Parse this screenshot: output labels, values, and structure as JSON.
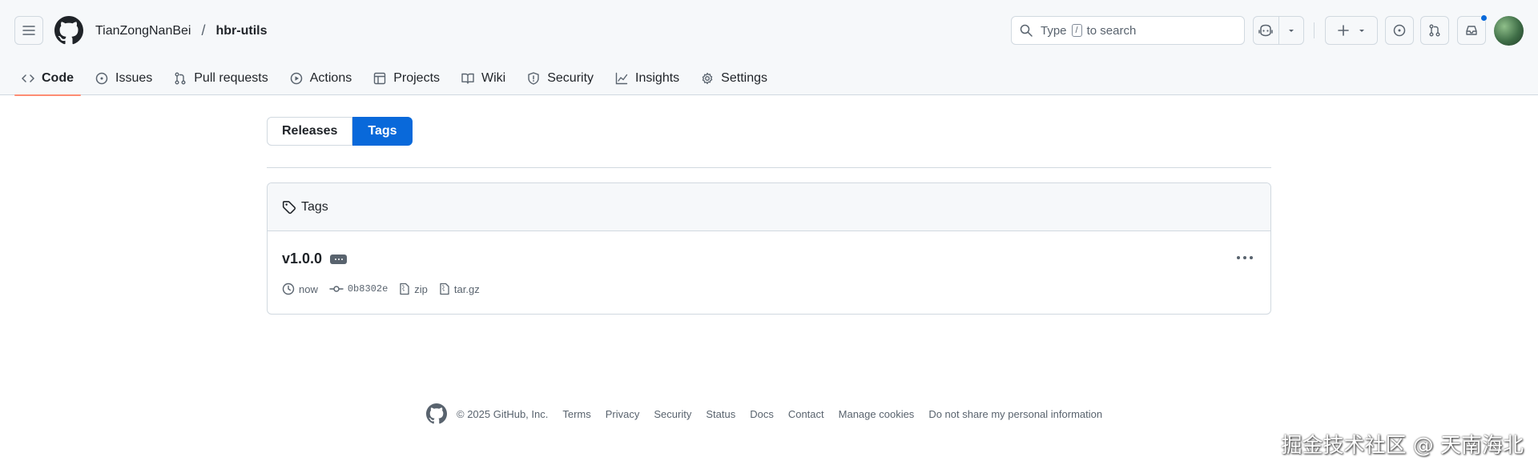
{
  "breadcrumb": {
    "owner": "TianZongNanBei",
    "separator": "/",
    "repo": "hbr-utils"
  },
  "search": {
    "prefix": "Type",
    "key": "/",
    "suffix": "to search"
  },
  "nav_tabs": [
    {
      "label": "Code",
      "icon": "code-icon",
      "selected": true
    },
    {
      "label": "Issues",
      "icon": "issue-icon"
    },
    {
      "label": "Pull requests",
      "icon": "pull-request-icon"
    },
    {
      "label": "Actions",
      "icon": "play-icon"
    },
    {
      "label": "Projects",
      "icon": "table-icon"
    },
    {
      "label": "Wiki",
      "icon": "book-icon"
    },
    {
      "label": "Security",
      "icon": "shield-icon"
    },
    {
      "label": "Insights",
      "icon": "graph-icon"
    },
    {
      "label": "Settings",
      "icon": "gear-icon"
    }
  ],
  "segmented": {
    "releases": "Releases",
    "tags": "Tags",
    "active": "tags"
  },
  "tags_box": {
    "title": "Tags",
    "items": [
      {
        "name": "v1.0.0",
        "time": "now",
        "commit": "0b8302e",
        "zip": "zip",
        "targz": "tar.gz"
      }
    ]
  },
  "footer": {
    "copyright": "© 2025 GitHub, Inc.",
    "links": [
      "Terms",
      "Privacy",
      "Security",
      "Status",
      "Docs",
      "Contact",
      "Manage cookies",
      "Do not share my personal information"
    ]
  },
  "watermark": "掘金技术社区 @ 天南海北",
  "colors": {
    "accent": "#0969da",
    "tab_underline": "#fd8c73",
    "border": "#d1d9e0",
    "header_bg": "#f6f8fa"
  }
}
